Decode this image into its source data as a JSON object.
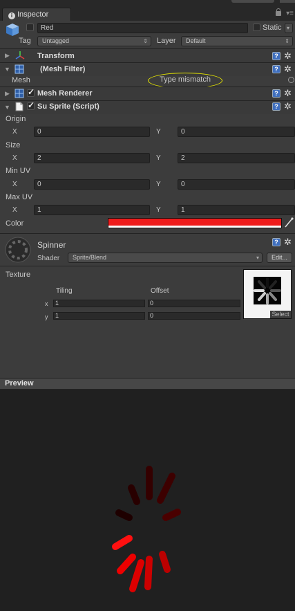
{
  "tab": {
    "label": "Inspector"
  },
  "object": {
    "name": "Red",
    "static_label": "Static",
    "tag_label": "Tag",
    "tag_value": "Untagged",
    "layer_label": "Layer",
    "layer_value": "Default"
  },
  "components": {
    "transform": "Transform",
    "mesh_filter": "(Mesh Filter)",
    "mesh_label": "Mesh",
    "mesh_value": "Type mismatch",
    "mesh_renderer": "Mesh Renderer",
    "script": "Su Sprite (Script)"
  },
  "script_fields": {
    "origin": {
      "label": "Origin",
      "x": "0",
      "y": "0"
    },
    "size": {
      "label": "Size",
      "x": "2",
      "y": "2"
    },
    "min_uv": {
      "label": "Min UV",
      "x": "0",
      "y": "0"
    },
    "max_uv": {
      "label": "Max UV",
      "x": "1",
      "y": "1"
    },
    "x_label": "X",
    "y_label": "Y",
    "color_label": "Color",
    "color_value": "#ee1c1c"
  },
  "material": {
    "name": "Spinner",
    "shader_label": "Shader",
    "shader_value": "Sprite/Blend",
    "edit_label": "Edit...",
    "texture_label": "Texture",
    "tiling_label": "Tiling",
    "offset_label": "Offset",
    "tiling_x": "1",
    "tiling_y": "1",
    "offset_x": "0",
    "offset_y": "0",
    "x_small": "x",
    "y_small": "y",
    "select_label": "Select"
  },
  "preview": {
    "title": "Preview"
  },
  "colors": {
    "accent_red": "#ee1c1c",
    "highlight_yellow": "#e6e600",
    "help_blue": "#3f6fbf"
  }
}
